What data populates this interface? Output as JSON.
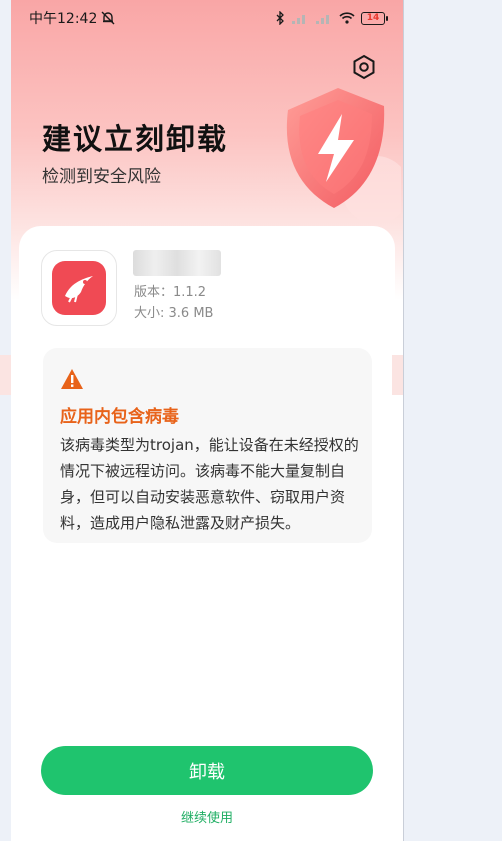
{
  "status_bar": {
    "time": "中午12:42",
    "battery": "14"
  },
  "header": {
    "title": "建议立刻卸载",
    "subtitle": "检测到安全风险"
  },
  "app": {
    "version": "版本：1.1.2",
    "size": "大小: 3.6 MB"
  },
  "warning": {
    "title": "应用内包含病毒",
    "text": "该病毒类型为trojan，能让设备在未经授权的情况下被远程访问。该病毒不能大量复制自身，但可以自动安装恶意软件、窃取用户资料，造成用户隐私泄露及财产损失。"
  },
  "actions": {
    "uninstall": "卸载",
    "continue": "继续使用"
  },
  "colors": {
    "accent_green": "#1fc46e",
    "warning_orange": "#e8631a",
    "danger_red": "#f04a54"
  },
  "icons": [
    "mute-bell-icon",
    "bluetooth-icon",
    "signal-icon",
    "wifi-icon",
    "battery-icon",
    "settings-icon",
    "shield-lightning-icon",
    "app-bird-icon",
    "warning-triangle-icon"
  ]
}
